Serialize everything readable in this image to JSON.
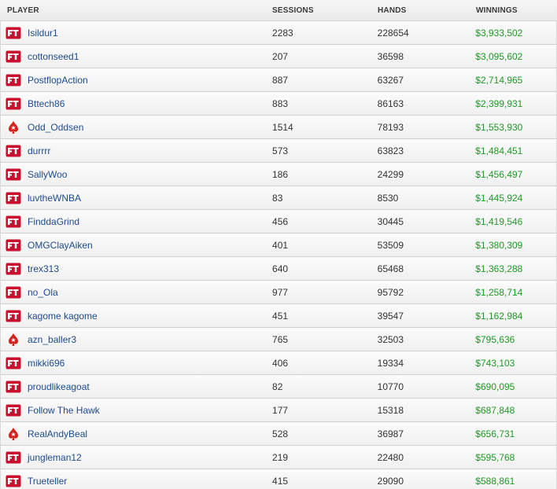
{
  "table": {
    "headers": {
      "player": "PLAYER",
      "sessions": "SESSIONS",
      "hands": "HANDS",
      "winnings": "WINNINGS"
    },
    "rows": [
      {
        "site": "ftp-icon",
        "player": "Isildur1",
        "sessions": "2283",
        "hands": "228654",
        "winnings": "$3,933,502"
      },
      {
        "site": "ftp-icon",
        "player": "cottonseed1",
        "sessions": "207",
        "hands": "36598",
        "winnings": "$3,095,602"
      },
      {
        "site": "ftp-icon",
        "player": "PostflopAction",
        "sessions": "887",
        "hands": "63267",
        "winnings": "$2,714,965"
      },
      {
        "site": "ftp-icon",
        "player": "Bttech86",
        "sessions": "883",
        "hands": "86163",
        "winnings": "$2,399,931"
      },
      {
        "site": "pokerstars-icon",
        "player": "Odd_Oddsen",
        "sessions": "1514",
        "hands": "78193",
        "winnings": "$1,553,930"
      },
      {
        "site": "ftp-icon",
        "player": "durrrr",
        "sessions": "573",
        "hands": "63823",
        "winnings": "$1,484,451"
      },
      {
        "site": "ftp-icon",
        "player": "SallyWoo",
        "sessions": "186",
        "hands": "24299",
        "winnings": "$1,456,497"
      },
      {
        "site": "ftp-icon",
        "player": "luvtheWNBA",
        "sessions": "83",
        "hands": "8530",
        "winnings": "$1,445,924"
      },
      {
        "site": "ftp-icon",
        "player": "FinddaGrind",
        "sessions": "456",
        "hands": "30445",
        "winnings": "$1,419,546"
      },
      {
        "site": "ftp-icon",
        "player": "OMGClayAiken",
        "sessions": "401",
        "hands": "53509",
        "winnings": "$1,380,309"
      },
      {
        "site": "ftp-icon",
        "player": "trex313",
        "sessions": "640",
        "hands": "65468",
        "winnings": "$1,363,288"
      },
      {
        "site": "ftp-icon",
        "player": "no_Ola",
        "sessions": "977",
        "hands": "95792",
        "winnings": "$1,258,714"
      },
      {
        "site": "ftp-icon",
        "player": "kagome kagome",
        "sessions": "451",
        "hands": "39547",
        "winnings": "$1,162,984"
      },
      {
        "site": "pokerstars-icon",
        "player": "azn_baller3",
        "sessions": "765",
        "hands": "32503",
        "winnings": "$795,636"
      },
      {
        "site": "ftp-icon",
        "player": "mikki696",
        "sessions": "406",
        "hands": "19334",
        "winnings": "$743,103"
      },
      {
        "site": "ftp-icon",
        "player": "proudlikeagoat",
        "sessions": "82",
        "hands": "10770",
        "winnings": "$690,095"
      },
      {
        "site": "ftp-icon",
        "player": "Follow The Hawk",
        "sessions": "177",
        "hands": "15318",
        "winnings": "$687,848"
      },
      {
        "site": "pokerstars-icon",
        "player": "RealAndyBeal",
        "sessions": "528",
        "hands": "36987",
        "winnings": "$656,731"
      },
      {
        "site": "ftp-icon",
        "player": "jungleman12",
        "sessions": "219",
        "hands": "22480",
        "winnings": "$595,768"
      },
      {
        "site": "ftp-icon",
        "player": "Trueteller",
        "sessions": "415",
        "hands": "29090",
        "winnings": "$588,861"
      }
    ]
  },
  "colors": {
    "player_name": "#1d4b8f",
    "winnings": "#1f9a24",
    "ftp_brand": "#c8102e",
    "pokerstars_brand": "#d5201b"
  }
}
